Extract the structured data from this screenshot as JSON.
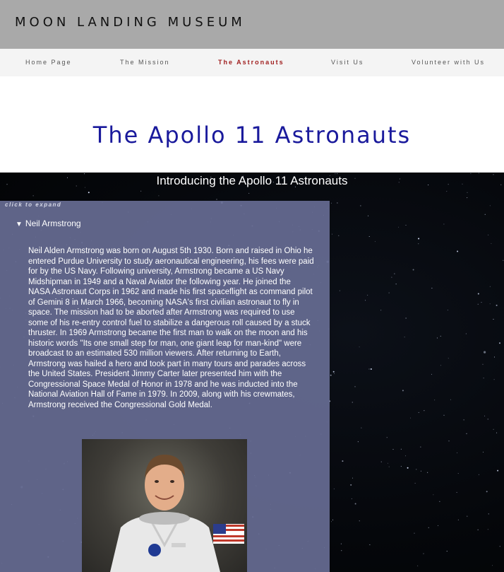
{
  "site": {
    "title": "MOON LANDING MUSEUM"
  },
  "nav": {
    "items": [
      {
        "label": "Home Page"
      },
      {
        "label": "The Mission"
      },
      {
        "label": "The Astronauts"
      },
      {
        "label": "Visit Us"
      },
      {
        "label": "Volunteer with Us"
      }
    ],
    "active_label": "The Astronauts"
  },
  "page": {
    "title": "The Apollo 11 Astronauts"
  },
  "section": {
    "heading": "Introducing the Apollo 11 Astronauts",
    "expand_hint": "click to expand"
  },
  "astronaut": {
    "name": "Neil Armstrong",
    "bio": "Neil Alden Armstrong was born on August 5th 1930. Born and raised in Ohio he entered Purdue University to study aeronautical engineering, his fees were paid for by the US Navy. Following university, Armstrong became a US Navy Midshipman in 1949 and a Naval Aviator the following year. He joined the NASA Astronaut Corps in 1962 and made his first spaceflight as command pilot of Gemini 8 in March 1966, becoming NASA's first civilian astronaut to fly in space. The mission had to be aborted after Armstrong was required to use some of his re-entry control fuel to stabilize a dangerous roll caused by a stuck thruster. In 1969 Armstrong became the first man to walk on the moon and his historic words \"Its one small step for man, one giant leap for man-kind\" were broadcast to an estimated 530 million viewers. After returning to Earth, Armstrong was hailed a hero and took part in many tours and parades across the United States. President Jimmy Carter later presented him with the Congressional Space Medal of Honor in 1978 and he was inducted into the National Aviation Hall of Fame in 1979. In 2009, along with his crewmates, Armstrong received the Congressional Gold Medal.",
    "expanded": true
  },
  "colors": {
    "header_bg": "#a9a9a9",
    "nav_bg": "#f4f4f4",
    "active_nav": "#a01e1e",
    "title_blue": "#1a1a9c",
    "panel_bg": "#676c94"
  }
}
